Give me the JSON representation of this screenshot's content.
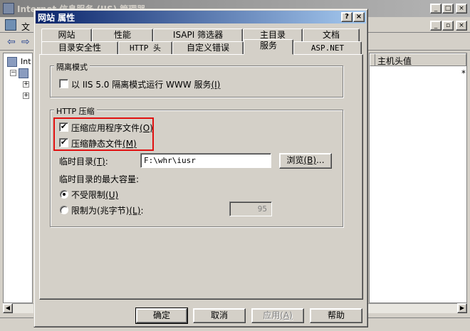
{
  "background_window": {
    "title": "Internet 信息服务 (IIS) 管理器",
    "menu_text": "文",
    "column_header": "主机头值",
    "asterisk": "*",
    "tree_root_label": "Int"
  },
  "dialog": {
    "title": "网站 属性",
    "help_button": "?",
    "close_button": "×",
    "tabs_row1": [
      "网站",
      "性能",
      "ISAPI 筛选器",
      "主目录",
      "文档"
    ],
    "tabs_row2": [
      "目录安全性",
      "HTTP 头",
      "自定义错误",
      "服务",
      "ASP.NET"
    ],
    "active_tab": "服务",
    "isolation_group": {
      "label": "隔离模式",
      "checkbox_label": "以 IIS 5.0 隔离模式运行 WWW 服务",
      "checkbox_hotkey": "(I)",
      "checked": false
    },
    "compression_group": {
      "label": "HTTP 压缩",
      "compress_app_label": "压缩应用程序文件",
      "compress_app_hotkey": "(O)",
      "compress_app_checked": true,
      "compress_static_label": "压缩静态文件",
      "compress_static_hotkey": "(M)",
      "compress_static_checked": true,
      "temp_dir_label": "临时目录",
      "temp_dir_hotkey": "(T)",
      "temp_dir_colon": ":",
      "temp_dir_value": "F:\\whr\\iusr",
      "browse_button": "浏览",
      "browse_hotkey": "(B)",
      "browse_ellipsis": "...",
      "max_size_label": "临时目录的最大容量:",
      "unlimited_label": "不受限制",
      "unlimited_hotkey": "(U)",
      "limit_label": "限制为(兆字节)",
      "limit_hotkey": "(L)",
      "limit_colon": ":",
      "selected_option": "unlimited",
      "limit_value": "95"
    },
    "buttons": {
      "ok": "确定",
      "cancel": "取消",
      "apply": "应用",
      "apply_hotkey": "(A)",
      "help": "帮助"
    }
  },
  "check_mark": "✔"
}
